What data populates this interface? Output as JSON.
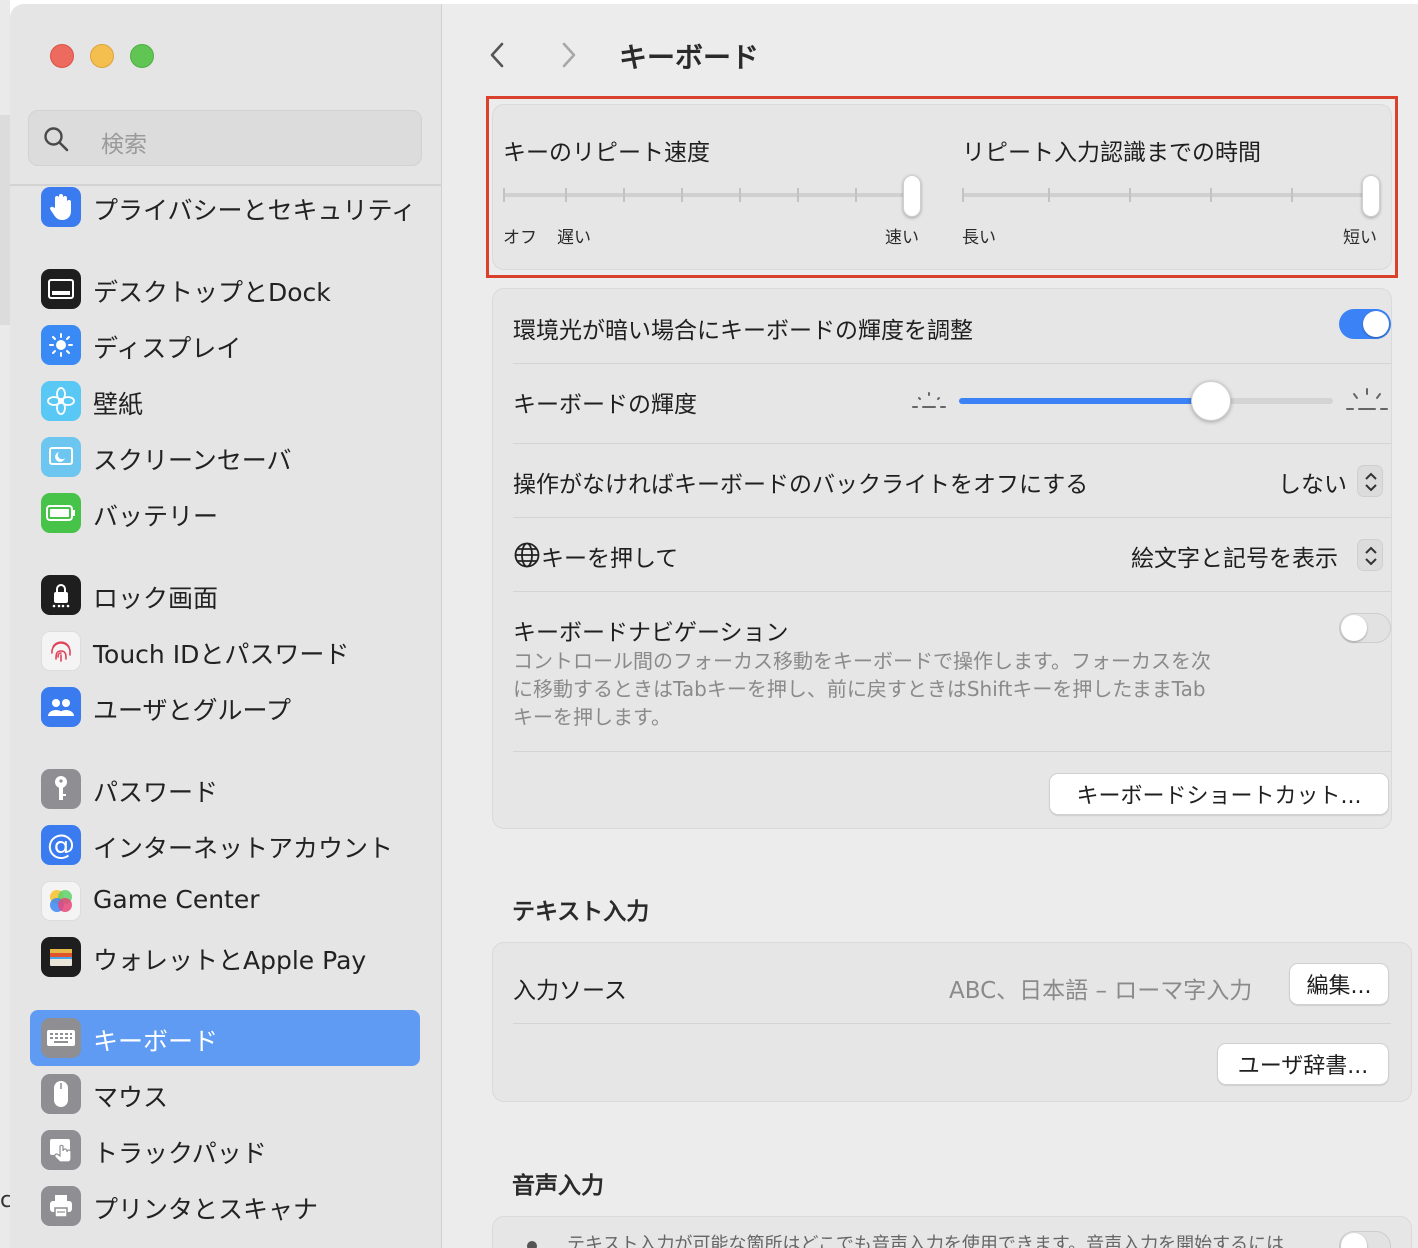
{
  "window_title": "キーボード",
  "edge_glyph": "c",
  "search": {
    "placeholder": "検索"
  },
  "sidebar": {
    "items": [
      {
        "label": "プライバシーとセキュリティ",
        "icon": "hand-icon",
        "color": "#3a7bf0"
      },
      {
        "label": "デスクトップとDock",
        "icon": "dock-icon",
        "color": "#1e1e1e"
      },
      {
        "label": "ディスプレイ",
        "icon": "sun-icon",
        "color": "#3a8af5"
      },
      {
        "label": "壁紙",
        "icon": "flower-icon",
        "color": "#5ac8f5"
      },
      {
        "label": "スクリーンセーバ",
        "icon": "screensaver-icon",
        "color": "#6cc6f0"
      },
      {
        "label": "バッテリー",
        "icon": "battery-icon",
        "color": "#47c34a"
      },
      {
        "label": "ロック画面",
        "icon": "lock-icon",
        "color": "#1e1e1e"
      },
      {
        "label": "Touch IDとパスワード",
        "icon": "fingerprint-icon",
        "color": "#f4f4f4"
      },
      {
        "label": "ユーザとグループ",
        "icon": "users-icon",
        "color": "#3a7bf0"
      },
      {
        "label": "パスワード",
        "icon": "key-icon",
        "color": "#8e8e93"
      },
      {
        "label": "インターネットアカウント",
        "icon": "at-icon",
        "color": "#3a7bf0"
      },
      {
        "label": "Game Center",
        "icon": "game-center-icon",
        "color": "#f4f4f4"
      },
      {
        "label": "ウォレットとApple Pay",
        "icon": "wallet-icon",
        "color": "#1e1e1e"
      },
      {
        "label": "キーボード",
        "icon": "keyboard-icon",
        "color": "#8e8e93",
        "selected": true
      },
      {
        "label": "マウス",
        "icon": "mouse-icon",
        "color": "#8e8e93"
      },
      {
        "label": "トラックパッド",
        "icon": "trackpad-icon",
        "color": "#8e8e93"
      },
      {
        "label": "プリンタとスキャナ",
        "icon": "printer-icon",
        "color": "#8e8e93"
      }
    ]
  },
  "repeat": {
    "speed_label": "キーのリピート速度",
    "speed_off": "オフ",
    "speed_slow": "遅い",
    "speed_fast": "速い",
    "speed_value_fraction": 1.0,
    "delay_label": "リピート入力認識までの時間",
    "delay_long": "長い",
    "delay_short": "短い",
    "delay_value_fraction": 1.0
  },
  "backlight": {
    "auto_label": "環境光が暗い場合にキーボードの輝度を調整",
    "auto_on": true,
    "brightness_label": "キーボードの輝度",
    "brightness_fraction": 0.67,
    "off_label": "操作がなければキーボードのバックライトをオフにする",
    "off_value": "しない"
  },
  "globe": {
    "label": "キーを押して",
    "value": "絵文字と記号を表示"
  },
  "navigation": {
    "label": "キーボードナビゲーション",
    "on": false,
    "desc1": "コントロール間のフォーカス移動をキーボードで操作します。フォーカスを次",
    "desc2": "に移動するときはTabキーを押し、前に戻すときはShiftキーを押したままTab",
    "desc3": "キーを押します。"
  },
  "shortcuts_button": "キーボードショートカット...",
  "text_input": {
    "heading": "テキスト入力",
    "source_label": "入力ソース",
    "source_value": "ABC、日本語 – ローマ字入力",
    "edit_button": "編集...",
    "dictionary_button": "ユーザ辞書..."
  },
  "dictation": {
    "heading": "音声入力",
    "partial_text": "テキスト入力が可能な箇所はどこでも音声入力を使用できます。音声入力を開始するには"
  },
  "colors": {
    "accent": "#3b82f6",
    "highlight": "#d9412c",
    "selected_sidebar": "#5f9bf3"
  }
}
